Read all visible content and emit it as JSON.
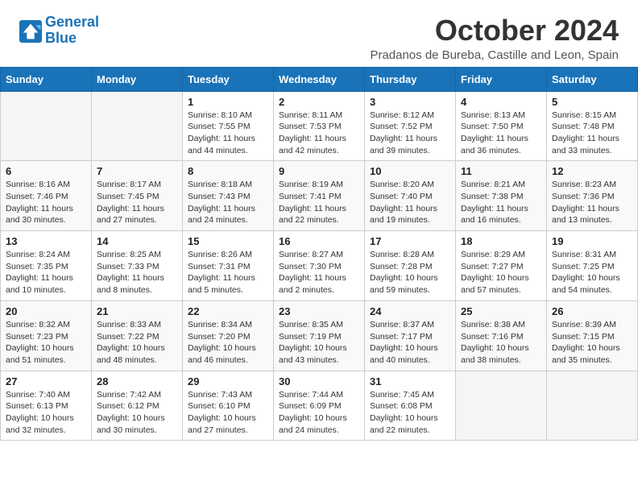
{
  "header": {
    "logo_line1": "General",
    "logo_line2": "Blue",
    "month_title": "October 2024",
    "location": "Pradanos de Bureba, Castille and Leon, Spain"
  },
  "days_of_week": [
    "Sunday",
    "Monday",
    "Tuesday",
    "Wednesday",
    "Thursday",
    "Friday",
    "Saturday"
  ],
  "weeks": [
    [
      {
        "day": "",
        "info": ""
      },
      {
        "day": "",
        "info": ""
      },
      {
        "day": "1",
        "info": "Sunrise: 8:10 AM\nSunset: 7:55 PM\nDaylight: 11 hours and 44 minutes."
      },
      {
        "day": "2",
        "info": "Sunrise: 8:11 AM\nSunset: 7:53 PM\nDaylight: 11 hours and 42 minutes."
      },
      {
        "day": "3",
        "info": "Sunrise: 8:12 AM\nSunset: 7:52 PM\nDaylight: 11 hours and 39 minutes."
      },
      {
        "day": "4",
        "info": "Sunrise: 8:13 AM\nSunset: 7:50 PM\nDaylight: 11 hours and 36 minutes."
      },
      {
        "day": "5",
        "info": "Sunrise: 8:15 AM\nSunset: 7:48 PM\nDaylight: 11 hours and 33 minutes."
      }
    ],
    [
      {
        "day": "6",
        "info": "Sunrise: 8:16 AM\nSunset: 7:46 PM\nDaylight: 11 hours and 30 minutes."
      },
      {
        "day": "7",
        "info": "Sunrise: 8:17 AM\nSunset: 7:45 PM\nDaylight: 11 hours and 27 minutes."
      },
      {
        "day": "8",
        "info": "Sunrise: 8:18 AM\nSunset: 7:43 PM\nDaylight: 11 hours and 24 minutes."
      },
      {
        "day": "9",
        "info": "Sunrise: 8:19 AM\nSunset: 7:41 PM\nDaylight: 11 hours and 22 minutes."
      },
      {
        "day": "10",
        "info": "Sunrise: 8:20 AM\nSunset: 7:40 PM\nDaylight: 11 hours and 19 minutes."
      },
      {
        "day": "11",
        "info": "Sunrise: 8:21 AM\nSunset: 7:38 PM\nDaylight: 11 hours and 16 minutes."
      },
      {
        "day": "12",
        "info": "Sunrise: 8:23 AM\nSunset: 7:36 PM\nDaylight: 11 hours and 13 minutes."
      }
    ],
    [
      {
        "day": "13",
        "info": "Sunrise: 8:24 AM\nSunset: 7:35 PM\nDaylight: 11 hours and 10 minutes."
      },
      {
        "day": "14",
        "info": "Sunrise: 8:25 AM\nSunset: 7:33 PM\nDaylight: 11 hours and 8 minutes."
      },
      {
        "day": "15",
        "info": "Sunrise: 8:26 AM\nSunset: 7:31 PM\nDaylight: 11 hours and 5 minutes."
      },
      {
        "day": "16",
        "info": "Sunrise: 8:27 AM\nSunset: 7:30 PM\nDaylight: 11 hours and 2 minutes."
      },
      {
        "day": "17",
        "info": "Sunrise: 8:28 AM\nSunset: 7:28 PM\nDaylight: 10 hours and 59 minutes."
      },
      {
        "day": "18",
        "info": "Sunrise: 8:29 AM\nSunset: 7:27 PM\nDaylight: 10 hours and 57 minutes."
      },
      {
        "day": "19",
        "info": "Sunrise: 8:31 AM\nSunset: 7:25 PM\nDaylight: 10 hours and 54 minutes."
      }
    ],
    [
      {
        "day": "20",
        "info": "Sunrise: 8:32 AM\nSunset: 7:23 PM\nDaylight: 10 hours and 51 minutes."
      },
      {
        "day": "21",
        "info": "Sunrise: 8:33 AM\nSunset: 7:22 PM\nDaylight: 10 hours and 48 minutes."
      },
      {
        "day": "22",
        "info": "Sunrise: 8:34 AM\nSunset: 7:20 PM\nDaylight: 10 hours and 46 minutes."
      },
      {
        "day": "23",
        "info": "Sunrise: 8:35 AM\nSunset: 7:19 PM\nDaylight: 10 hours and 43 minutes."
      },
      {
        "day": "24",
        "info": "Sunrise: 8:37 AM\nSunset: 7:17 PM\nDaylight: 10 hours and 40 minutes."
      },
      {
        "day": "25",
        "info": "Sunrise: 8:38 AM\nSunset: 7:16 PM\nDaylight: 10 hours and 38 minutes."
      },
      {
        "day": "26",
        "info": "Sunrise: 8:39 AM\nSunset: 7:15 PM\nDaylight: 10 hours and 35 minutes."
      }
    ],
    [
      {
        "day": "27",
        "info": "Sunrise: 7:40 AM\nSunset: 6:13 PM\nDaylight: 10 hours and 32 minutes."
      },
      {
        "day": "28",
        "info": "Sunrise: 7:42 AM\nSunset: 6:12 PM\nDaylight: 10 hours and 30 minutes."
      },
      {
        "day": "29",
        "info": "Sunrise: 7:43 AM\nSunset: 6:10 PM\nDaylight: 10 hours and 27 minutes."
      },
      {
        "day": "30",
        "info": "Sunrise: 7:44 AM\nSunset: 6:09 PM\nDaylight: 10 hours and 24 minutes."
      },
      {
        "day": "31",
        "info": "Sunrise: 7:45 AM\nSunset: 6:08 PM\nDaylight: 10 hours and 22 minutes."
      },
      {
        "day": "",
        "info": ""
      },
      {
        "day": "",
        "info": ""
      }
    ]
  ]
}
